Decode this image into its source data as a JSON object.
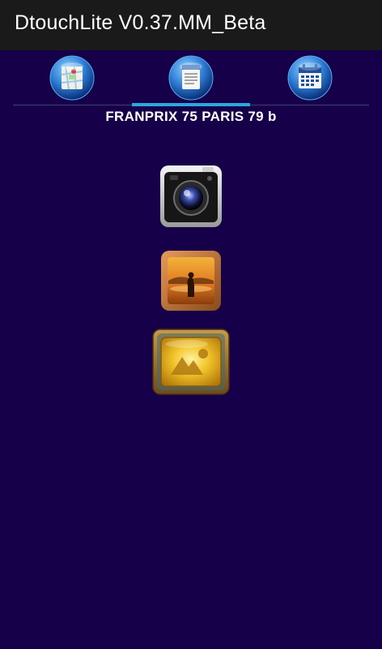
{
  "app_bar": {
    "title": "DtouchLite V0.37.MM_Beta"
  },
  "tabs": [
    {
      "icon": "map-icon",
      "selected": false
    },
    {
      "icon": "document-icon",
      "selected": true
    },
    {
      "icon": "calendar-icon",
      "selected": false
    }
  ],
  "store": {
    "name": "FRANPRIX 75 PARIS 79 b"
  },
  "actions": [
    {
      "icon": "camera-icon"
    },
    {
      "icon": "photo-gallery-icon"
    },
    {
      "icon": "image-icon"
    }
  ],
  "colors": {
    "background": "#16004a",
    "app_bar": "#1a1a1a",
    "tab_indicator": "#2aa8e0"
  }
}
